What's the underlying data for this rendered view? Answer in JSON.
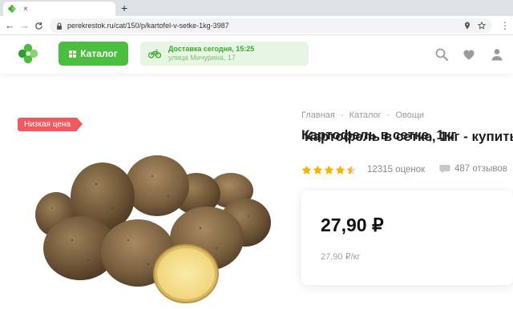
{
  "browser": {
    "tab_title": "Картофель в сетке, 1кг - купить",
    "tab_close": "×",
    "new_tab": "+",
    "back": "←",
    "forward": "→",
    "reload": "C",
    "url": "perekrestok.ru/cat/150/p/kartofel-v-setke-1kg-3987",
    "menu": "⋮"
  },
  "header": {
    "catalog_label": "Каталог",
    "delivery_title": "Доставка сегодня, 15:25",
    "delivery_address": "улица Мичурина, 17",
    "brand_color": "#4bbd3f"
  },
  "product": {
    "badge": "Низкая цена",
    "breadcrumb": [
      "Главная",
      "Каталог",
      "Овощи"
    ],
    "breadcrumb_separator": "·",
    "title": "Картофель в сетке, 1кг",
    "rating": 4.5,
    "ratings_count": "12315 оценок",
    "reviews_count": "487 отзывов",
    "price": "27,90 ₽",
    "unit_price": "27,90 ₽/кг"
  }
}
